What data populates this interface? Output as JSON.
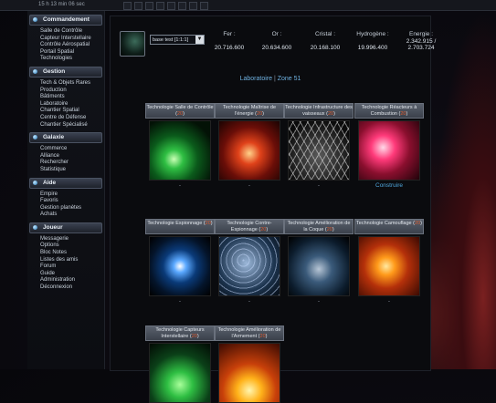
{
  "topbar": {
    "clock": "15 h 13 min 06 sec"
  },
  "sidebar": {
    "sections": [
      {
        "label": "Commandement",
        "items": [
          "Salle de Contrôle",
          "Capteur Interstellaire",
          "Contrôle Aérospatial",
          "Portail Spatial",
          "Technologies"
        ]
      },
      {
        "label": "Gestion",
        "items": [
          "Tech & Objets Rares",
          "Production",
          "Bâtiments",
          "Laboratoire",
          "Chantier Spatial",
          "Centre de Défense",
          "Chantier Spécialisé"
        ]
      },
      {
        "label": "Galaxie",
        "items": [
          "Commerce",
          "Alliance",
          "Rechercher",
          "Statistique"
        ]
      },
      {
        "label": "Aide",
        "items": [
          "Empire",
          "Favoris",
          "Gestion planètes",
          "Achats"
        ]
      },
      {
        "label": "Joueur",
        "items": [
          "Messagerie",
          "Options",
          "Bloc Notes",
          "Listes des amis",
          "Forum",
          "Guide",
          "Administration",
          "Déconnexion"
        ]
      }
    ]
  },
  "planet": {
    "selected": "base test [1:1:1]",
    "arrow": "▼"
  },
  "resources": [
    {
      "name": "Fer :",
      "value": "20.716.600"
    },
    {
      "name": "Or :",
      "value": "20.634.600"
    },
    {
      "name": "Cristal :",
      "value": "20.168.100"
    },
    {
      "name": "Hydrogène :",
      "value": "19.996.400"
    },
    {
      "name": "Energie :",
      "value": "2.342.915 / 2.703.724"
    }
  ],
  "breadcrumb": {
    "first": "Laboratoire",
    "sep": "|",
    "second": "Zone 51"
  },
  "technologies": [
    {
      "name": "Technologie Salle de Contrôle",
      "level": "20",
      "action": "-"
    },
    {
      "name": "Technologie Maîtrise de l'énergie",
      "level": "20",
      "action": "-"
    },
    {
      "name": "Technologie Infrastructure des vaisseaux",
      "level": "20",
      "action": "-"
    },
    {
      "name": "Technologie Réacteurs à Combustion",
      "level": "20",
      "action": "Construire"
    },
    {
      "name": "Technologie Espionnage",
      "level": "20",
      "action": "-"
    },
    {
      "name": "Technologie Contre-Espionnage",
      "level": "20",
      "action": "-"
    },
    {
      "name": "Technologie Amélioration de la Coque",
      "level": "20",
      "action": "-"
    },
    {
      "name": "Technologie Camouflage",
      "level": "20",
      "action": "-"
    },
    {
      "name": "Technologie Capteurs Interstellaire",
      "level": "20",
      "action": ""
    },
    {
      "name": "Technologie Amélioration de l'Armement",
      "level": "20",
      "action": ""
    }
  ],
  "icons": {
    "thumb": "planet-thumbnail",
    "menu": "bullet-orb-icon"
  }
}
